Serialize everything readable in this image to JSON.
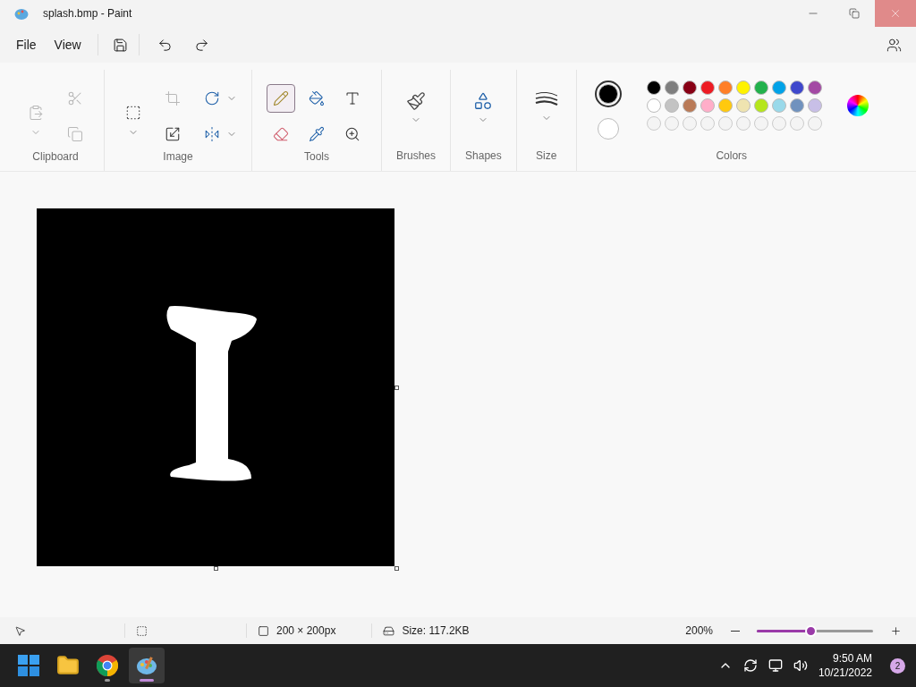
{
  "window": {
    "title": "splash.bmp - Paint"
  },
  "menu": [
    {
      "label": "File"
    },
    {
      "label": "View"
    }
  ],
  "ribbon": [
    {
      "label": "Clipboard",
      "kind": "clipboard",
      "tools": [
        {
          "kind": "paste",
          "disabled": true
        },
        {
          "kind": "cut",
          "disabled": true
        },
        {
          "kind": "copy",
          "disabled": true
        }
      ]
    },
    {
      "label": "Image",
      "tools": [
        {
          "kind": "select",
          "disabled": false
        },
        {
          "kind": "crop",
          "disabled": true
        },
        {
          "kind": "rotate",
          "disabled": false
        },
        {
          "kind": "resize",
          "disabled": false
        },
        {
          "kind": "flip",
          "disabled": false
        }
      ]
    },
    {
      "label": "Tools",
      "kind": "tools",
      "tools": [
        {
          "kind": "pencil",
          "selected": true
        },
        {
          "kind": "fill",
          "selected": false
        },
        {
          "kind": "text",
          "selected": false
        },
        {
          "kind": "eraser",
          "selected": false
        },
        {
          "kind": "picker",
          "selected": false
        },
        {
          "kind": "magnifier",
          "selected": false
        }
      ]
    },
    {
      "label": "Brushes",
      "kind": "brushes"
    },
    {
      "label": "Shapes",
      "kind": "shapes"
    },
    {
      "label": "Size",
      "kind": "size"
    }
  ],
  "colors": {
    "label": "Colors",
    "primary": {
      "color": "#000000"
    },
    "secondary": {
      "color": "#ffffff"
    },
    "palette": [
      {
        "color": "#000000"
      },
      {
        "color": "#7f7f7f"
      },
      {
        "color": "#880015"
      },
      {
        "color": "#ed1c24"
      },
      {
        "color": "#ff7f27"
      },
      {
        "color": "#fff200"
      },
      {
        "color": "#22b14c"
      },
      {
        "color": "#00a2e8"
      },
      {
        "color": "#3f48cc"
      },
      {
        "color": "#a349a4"
      },
      {
        "color": "#ffffff"
      },
      {
        "color": "#c3c3c3"
      },
      {
        "color": "#b97a57"
      },
      {
        "color": "#ffaec9"
      },
      {
        "color": "#ffc90e"
      },
      {
        "color": "#efe4b0"
      },
      {
        "color": "#b5e61d"
      },
      {
        "color": "#99d9ea"
      },
      {
        "color": "#7092be"
      },
      {
        "color": "#c8bfe7"
      }
    ]
  },
  "status_bar": {
    "dimensions": "200 × 200px",
    "file_size": "Size: 117.2KB",
    "zoom": "200%",
    "zoom_slider": {
      "level": 0.46
    }
  },
  "taskbar": {
    "apps": [
      {
        "kind": "start",
        "running": false,
        "selected": false
      },
      {
        "kind": "explorer",
        "running": false,
        "selected": false
      },
      {
        "kind": "chrome",
        "running": true,
        "selected": false
      },
      {
        "kind": "paint",
        "running": true,
        "selected": true
      }
    ],
    "time": "9:50 AM",
    "date": "10/21/2022",
    "notifications": "2"
  }
}
